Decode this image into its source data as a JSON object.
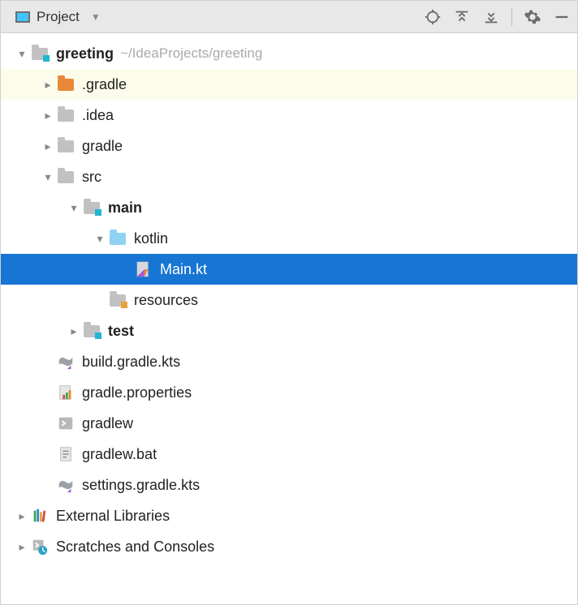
{
  "toolbar": {
    "title": "Project"
  },
  "tree": {
    "root": {
      "name": "greeting",
      "path": "~/IdeaProjects/greeting"
    },
    "gradle_hidden": ".gradle",
    "idea": ".idea",
    "gradle": "gradle",
    "src": "src",
    "main": "main",
    "kotlin": "kotlin",
    "main_kt": "Main.kt",
    "resources": "resources",
    "test": "test",
    "build_gradle": "build.gradle.kts",
    "gradle_properties": "gradle.properties",
    "gradlew": "gradlew",
    "gradlew_bat": "gradlew.bat",
    "settings_gradle": "settings.gradle.kts",
    "external_libs": "External Libraries",
    "scratches": "Scratches and Consoles"
  }
}
